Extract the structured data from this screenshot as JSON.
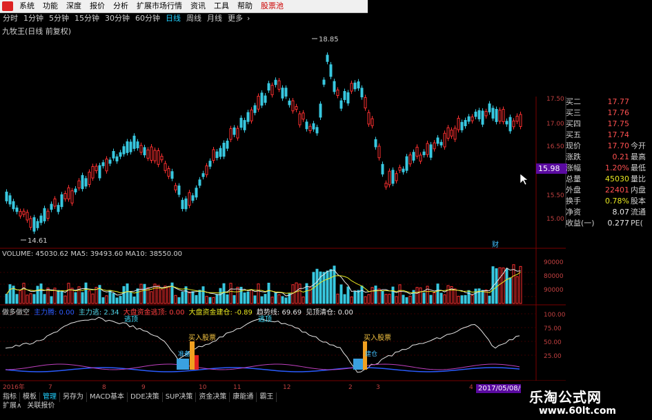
{
  "menu": {
    "items": [
      "系统",
      "功能",
      "深度",
      "报价",
      "分析",
      "扩展市场行情",
      "资讯",
      "工具",
      "帮助",
      "股票池"
    ]
  },
  "periods": {
    "items": [
      "分时",
      "1分钟",
      "5分钟",
      "15分钟",
      "30分钟",
      "60分钟",
      "日线",
      "周线",
      "月线",
      "更多"
    ],
    "active": "日线"
  },
  "stock_title": "九牧王(日线 前复权)",
  "price_chart": {
    "high_label": "18.85",
    "low_label": "14.61",
    "y_ticks": [
      "17.50",
      "17.00",
      "16.50",
      "15.50",
      "15.00"
    ],
    "current_flag": "15.98",
    "marker": "财"
  },
  "volume": {
    "label": "VOLUME: 45030.62  MA5: 39493.60  MA10: 38550.00",
    "y_ticks": [
      "90000",
      "80000",
      "90000"
    ]
  },
  "indicator": {
    "items": [
      {
        "text": "做多做空",
        "color": "#d0d0d0"
      },
      {
        "text": "主力腾: 0.00",
        "color": "#2a5cff"
      },
      {
        "text": "主力逃: 2.34",
        "color": "#4fd6e8"
      },
      {
        "text": "大盘资金逃顶: 0.00",
        "color": "#ff4040"
      },
      {
        "text": "大盘资金建仓: -0.89",
        "color": "#e8e820"
      },
      {
        "text": "趋势线: 69.69",
        "color": "#e8e8e8"
      },
      {
        "text": "见顶清仓: 0.00",
        "color": "#e8e8e8"
      }
    ],
    "y_ticks": [
      "100.00",
      "75.00",
      "50.00",
      "25.00"
    ],
    "annotations": {
      "escape": "逃顶",
      "buy": "买入股票",
      "build": "建仓",
      "prep": "准备"
    }
  },
  "x_axis": {
    "labels": [
      "2016年",
      "7",
      "8",
      "9",
      "10",
      "11",
      "12",
      "2",
      "3",
      "4"
    ],
    "date_flag": "2017/05/08/一"
  },
  "quote": {
    "rows": [
      {
        "k": "买二",
        "v": "17.77",
        "x": "",
        "vc": "#ff5050"
      },
      {
        "k": "买三",
        "v": "17.76",
        "x": "",
        "vc": "#ff5050"
      },
      {
        "k": "买四",
        "v": "17.75",
        "x": "",
        "vc": "#ff5050"
      },
      {
        "k": "买五",
        "v": "17.74",
        "x": "",
        "vc": "#ff5050"
      },
      {
        "k": "现价",
        "v": "17.70",
        "x": "今开",
        "vc": "#ff5050"
      },
      {
        "k": "涨跌",
        "v": "0.21",
        "x": "最高",
        "vc": "#ff5050"
      },
      {
        "k": "涨幅",
        "v": "1.20%",
        "x": "最低",
        "vc": "#ff5050"
      },
      {
        "k": "总量",
        "v": "45030",
        "x": "量比",
        "vc": "#e8e820"
      },
      {
        "k": "外盘",
        "v": "22401",
        "x": "内盘",
        "vc": "#ff5050"
      },
      {
        "k": "换手",
        "v": "0.78%",
        "x": "股本",
        "vc": "#e8e820"
      },
      {
        "k": "净资",
        "v": "8.07",
        "x": "流通",
        "vc": "#e8e8e8"
      },
      {
        "k": "收益(一)",
        "v": "0.277",
        "x": "PE(",
        "vc": "#e8e8e8"
      }
    ]
  },
  "bottom_tabs": {
    "row1": [
      "指标",
      "模板",
      "管理",
      "另存为",
      "MACD基本",
      "DDE决策",
      "SUP决策",
      "资金决策",
      "康能通",
      "霸王"
    ],
    "row1_active": "管理",
    "row2": [
      "扩展∧",
      "关联报价"
    ]
  },
  "watermark": {
    "line1": "乐淘公式网",
    "line2": "www.60lt.com"
  },
  "colors": {
    "up": "#ff3030",
    "down": "#38c8e0",
    "grid": "#7a0000",
    "bg": "#000000"
  }
}
